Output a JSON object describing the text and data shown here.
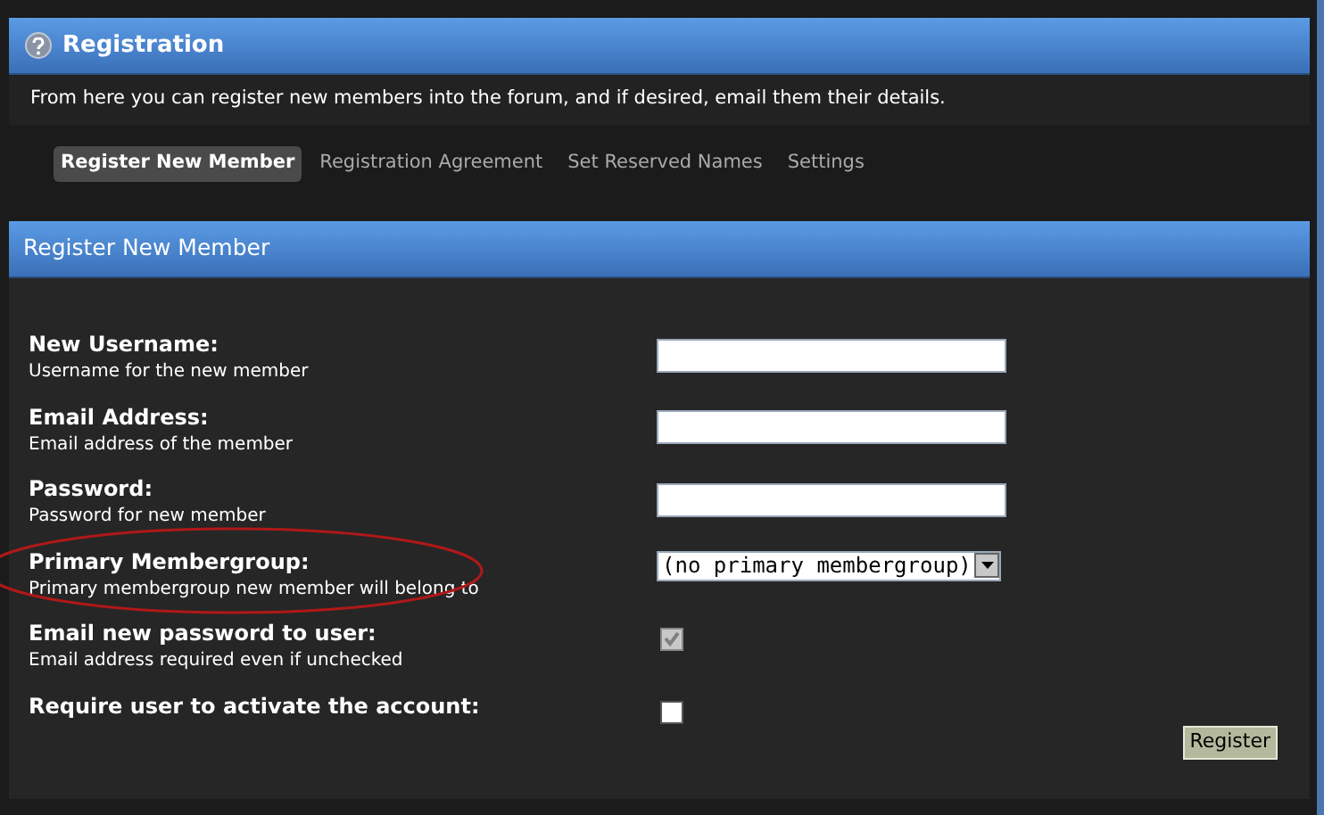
{
  "header": {
    "title": "Registration"
  },
  "description": "From here you can register new members into the forum, and if desired, email them their details.",
  "tabs": [
    {
      "label": "Register New Member",
      "selected": true
    },
    {
      "label": "Registration Agreement",
      "selected": false
    },
    {
      "label": "Set Reserved Names",
      "selected": false
    },
    {
      "label": "Settings",
      "selected": false
    }
  ],
  "section": {
    "title": "Register New Member"
  },
  "fields": [
    {
      "kind": "text",
      "label": "New Username:",
      "hint": "Username for the new member"
    },
    {
      "kind": "text",
      "label": "Email Address:",
      "hint": "Email address of the member"
    },
    {
      "kind": "text",
      "label": "Password:",
      "hint": "Password for new member"
    },
    {
      "kind": "select",
      "label": "Primary Membergroup:",
      "hint": "Primary membergroup new member will belong to",
      "value": "(no primary membergroup)"
    },
    {
      "kind": "checkbox",
      "label": "Email new password to user:",
      "hint": "Email address required even if unchecked",
      "checked": true,
      "disabled": true
    },
    {
      "kind": "checkbox",
      "label": "Require user to activate the account:",
      "checked": false,
      "disabled": false
    }
  ],
  "submit": "Register"
}
